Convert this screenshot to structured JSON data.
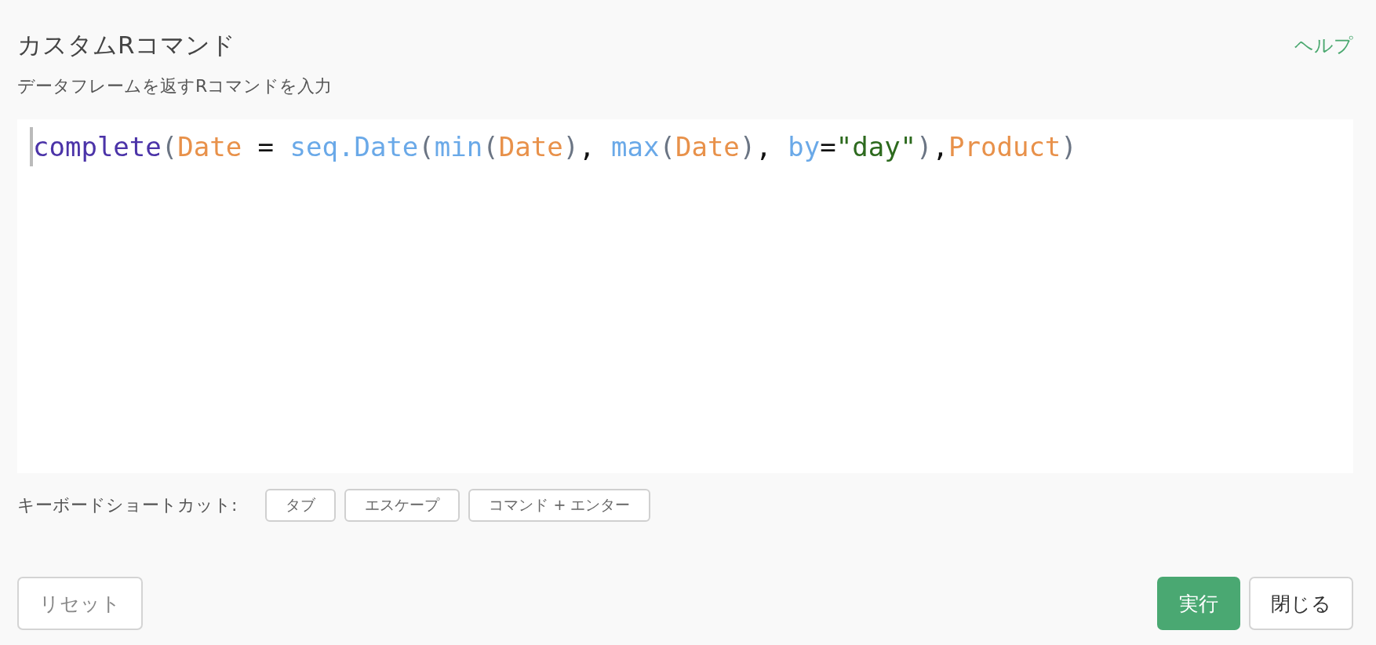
{
  "title": "カスタムRコマンド",
  "help_link": "ヘルプ",
  "subtitle": "データフレームを返すRコマンドを入力",
  "editor": {
    "code_tokens": [
      {
        "text": "complete",
        "kind": "function"
      },
      {
        "text": "(",
        "kind": "paren"
      },
      {
        "text": "Date",
        "kind": "variable"
      },
      {
        "text": " = ",
        "kind": "operator"
      },
      {
        "text": "seq.Date",
        "kind": "call"
      },
      {
        "text": "(",
        "kind": "paren"
      },
      {
        "text": "min",
        "kind": "call"
      },
      {
        "text": "(",
        "kind": "paren"
      },
      {
        "text": "Date",
        "kind": "variable"
      },
      {
        "text": ")",
        "kind": "paren"
      },
      {
        "text": ", ",
        "kind": "operator"
      },
      {
        "text": "max",
        "kind": "call"
      },
      {
        "text": "(",
        "kind": "paren"
      },
      {
        "text": "Date",
        "kind": "variable"
      },
      {
        "text": ")",
        "kind": "paren"
      },
      {
        "text": ", ",
        "kind": "operator"
      },
      {
        "text": "by",
        "kind": "call"
      },
      {
        "text": "=",
        "kind": "operator"
      },
      {
        "text": "\"day\"",
        "kind": "string"
      },
      {
        "text": ")",
        "kind": "paren"
      },
      {
        "text": ",",
        "kind": "operator"
      },
      {
        "text": "Product",
        "kind": "variable"
      },
      {
        "text": ")",
        "kind": "paren"
      }
    ]
  },
  "shortcuts": {
    "label": "キーボードショートカット:",
    "keys": [
      "タブ",
      "エスケープ",
      "コマンド + エンター"
    ]
  },
  "buttons": {
    "reset": "リセット",
    "run": "実行",
    "close": "閉じる"
  }
}
